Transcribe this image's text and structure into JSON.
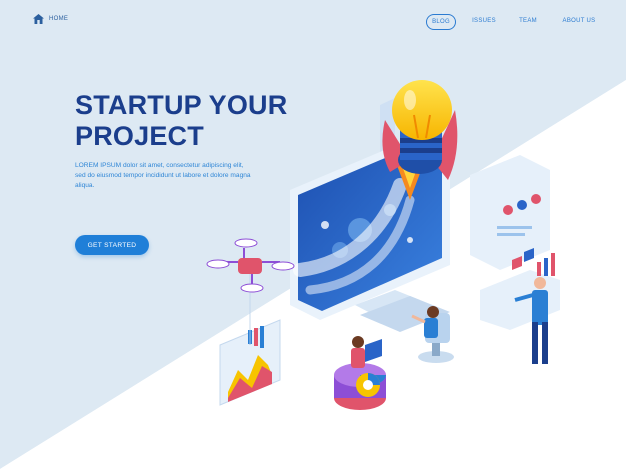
{
  "nav": {
    "home_label": "HOME",
    "items": [
      {
        "label": "BLOG",
        "active": true
      },
      {
        "label": "ISSUES"
      },
      {
        "label": "TEAM"
      },
      {
        "label": "ABOUT US"
      }
    ]
  },
  "hero": {
    "title_line1": "STARTUP YOUR",
    "title_line2": "PROJECT",
    "description": "LOREM IPSUM dolor sit amet, consectetur adipiscing elit, sed do eiusmod tempor incididunt ut labore et dolore magna aliqua.",
    "cta_label": "GET STARTED"
  },
  "icons": [
    "home-icon",
    "lightbulb-icon",
    "rocket-icon",
    "drone-icon"
  ],
  "colors": {
    "title": "#1b3e8c",
    "accent": "#1f7fd8",
    "background_band": "#dde9f3"
  }
}
